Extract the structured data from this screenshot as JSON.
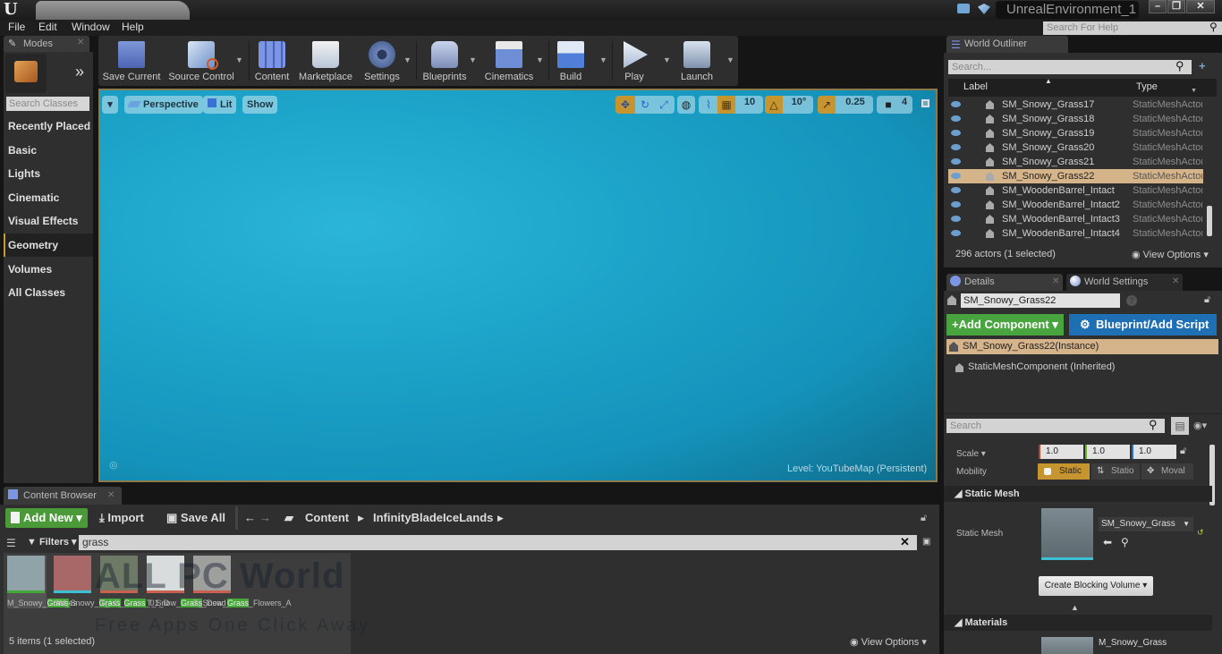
{
  "window": {
    "project_name": "UnrealEnvironment_1",
    "help_search_placeholder": "Search For Help",
    "controls": {
      "minimize": "–",
      "restore": "❐",
      "close": "✕"
    }
  },
  "menu": [
    "File",
    "Edit",
    "Window",
    "Help"
  ],
  "modes": {
    "tab_label": "Modes",
    "search_placeholder": "Search Classes",
    "categories": [
      "Recently Placed",
      "Basic",
      "Lights",
      "Cinematic",
      "Visual Effects",
      "Geometry",
      "Volumes",
      "All Classes"
    ],
    "active_category": "Geometry"
  },
  "toolbar": {
    "buttons": [
      {
        "label": "Save Current",
        "icon": "save-icon"
      },
      {
        "label": "Source Control",
        "icon": "source-control-icon"
      },
      {
        "label": "Content",
        "icon": "content-icon"
      },
      {
        "label": "Marketplace",
        "icon": "marketplace-icon"
      },
      {
        "label": "Settings",
        "icon": "settings-gear-icon"
      },
      {
        "label": "Blueprints",
        "icon": "blueprints-icon"
      },
      {
        "label": "Cinematics",
        "icon": "clapperboard-icon"
      },
      {
        "label": "Build",
        "icon": "build-icon"
      },
      {
        "label": "Play",
        "icon": "play-icon"
      },
      {
        "label": "Launch",
        "icon": "launch-icon"
      }
    ]
  },
  "viewport": {
    "view_mode": "Perspective",
    "lighting": "Lit",
    "show": "Show",
    "grid_snap": "10",
    "rotation_snap": "10°",
    "scale_snap": "0.25",
    "camera_speed": "4",
    "level_label": "Level:  YouTubeMap (Persistent)",
    "colors": {
      "accent": "#c7952f",
      "sky": "#1a9fc5"
    }
  },
  "content_browser": {
    "tab_label": "Content Browser",
    "add_new": "Add New",
    "import": "Import",
    "save_all": "Save All",
    "path": [
      "Content",
      "InfinityBladeIceLands"
    ],
    "filters": "Filters",
    "search_value": "grass",
    "assets": [
      {
        "pre": "M_Snowy_",
        "match": "Grass",
        "post": "es",
        "bar_color": "#47a83a",
        "thumb": "#8fa3a8"
      },
      {
        "pre": "SM_Snowy_",
        "match": "Grass",
        "post": "",
        "bar_color": "#3bc0d6",
        "thumb": "#a86868"
      },
      {
        "pre": "T_LS_",
        "match": "Grass",
        "post": "_01_D",
        "bar_color": "#c8614f",
        "thumb": "#6e7a66"
      },
      {
        "pre": "T_Snow_",
        "match": "Grass",
        "post": "_Dead_B",
        "bar_color": "#c8614f",
        "thumb": "#d9dcdc"
      },
      {
        "pre": "T_Snow_",
        "match": "Grass",
        "post": "_Flowers_A",
        "bar_color": "#c8614f",
        "thumb": "#9ea09e"
      }
    ],
    "status": "5 items (1 selected)",
    "view_options": "View Options",
    "watermark": "ALL PC World",
    "watermark_sub": "Free Apps One Click Away"
  },
  "world_outliner": {
    "tab_label": "World Outliner",
    "search_placeholder": "Search...",
    "columns": {
      "label": "Label",
      "type": "Type"
    },
    "rows": [
      {
        "label": "SM_Snowy_Grass17",
        "type": "StaticMeshActor"
      },
      {
        "label": "SM_Snowy_Grass18",
        "type": "StaticMeshActor"
      },
      {
        "label": "SM_Snowy_Grass19",
        "type": "StaticMeshActor"
      },
      {
        "label": "SM_Snowy_Grass20",
        "type": "StaticMeshActor"
      },
      {
        "label": "SM_Snowy_Grass21",
        "type": "StaticMeshActor"
      },
      {
        "label": "SM_Snowy_Grass22",
        "type": "StaticMeshActor",
        "selected": true
      },
      {
        "label": "SM_WoodenBarrel_Intact",
        "type": "StaticMeshActor"
      },
      {
        "label": "SM_WoodenBarrel_Intact2",
        "type": "StaticMeshActor"
      },
      {
        "label": "SM_WoodenBarrel_Intact3",
        "type": "StaticMeshActor"
      },
      {
        "label": "SM_WoodenBarrel_Intact4",
        "type": "StaticMeshActor"
      }
    ],
    "status": "296 actors (1 selected)",
    "view_options": "View Options"
  },
  "details": {
    "tab_label": "Details",
    "world_settings_tab": "World Settings",
    "actor_name": "SM_Snowy_Grass22",
    "add_component": "Add Component",
    "blueprint_script": "Blueprint/Add Script",
    "instance_row": "SM_Snowy_Grass22(Instance)",
    "component_row": "StaticMeshComponent (Inherited)",
    "search_placeholder": "Search",
    "scale_label": "Scale",
    "scale": [
      "1.0",
      "1.0",
      "1.0"
    ],
    "mobility_label": "Mobility",
    "mobility_options": [
      "Static",
      "Statio",
      "Moval"
    ],
    "static_mesh_section": "Static Mesh",
    "static_mesh_label": "Static Mesh",
    "static_mesh_value": "SM_Snowy_Grass",
    "create_blocking_volume": "Create Blocking Volume",
    "materials_section": "Materials",
    "material_value": "M_Snowy_Grass"
  }
}
